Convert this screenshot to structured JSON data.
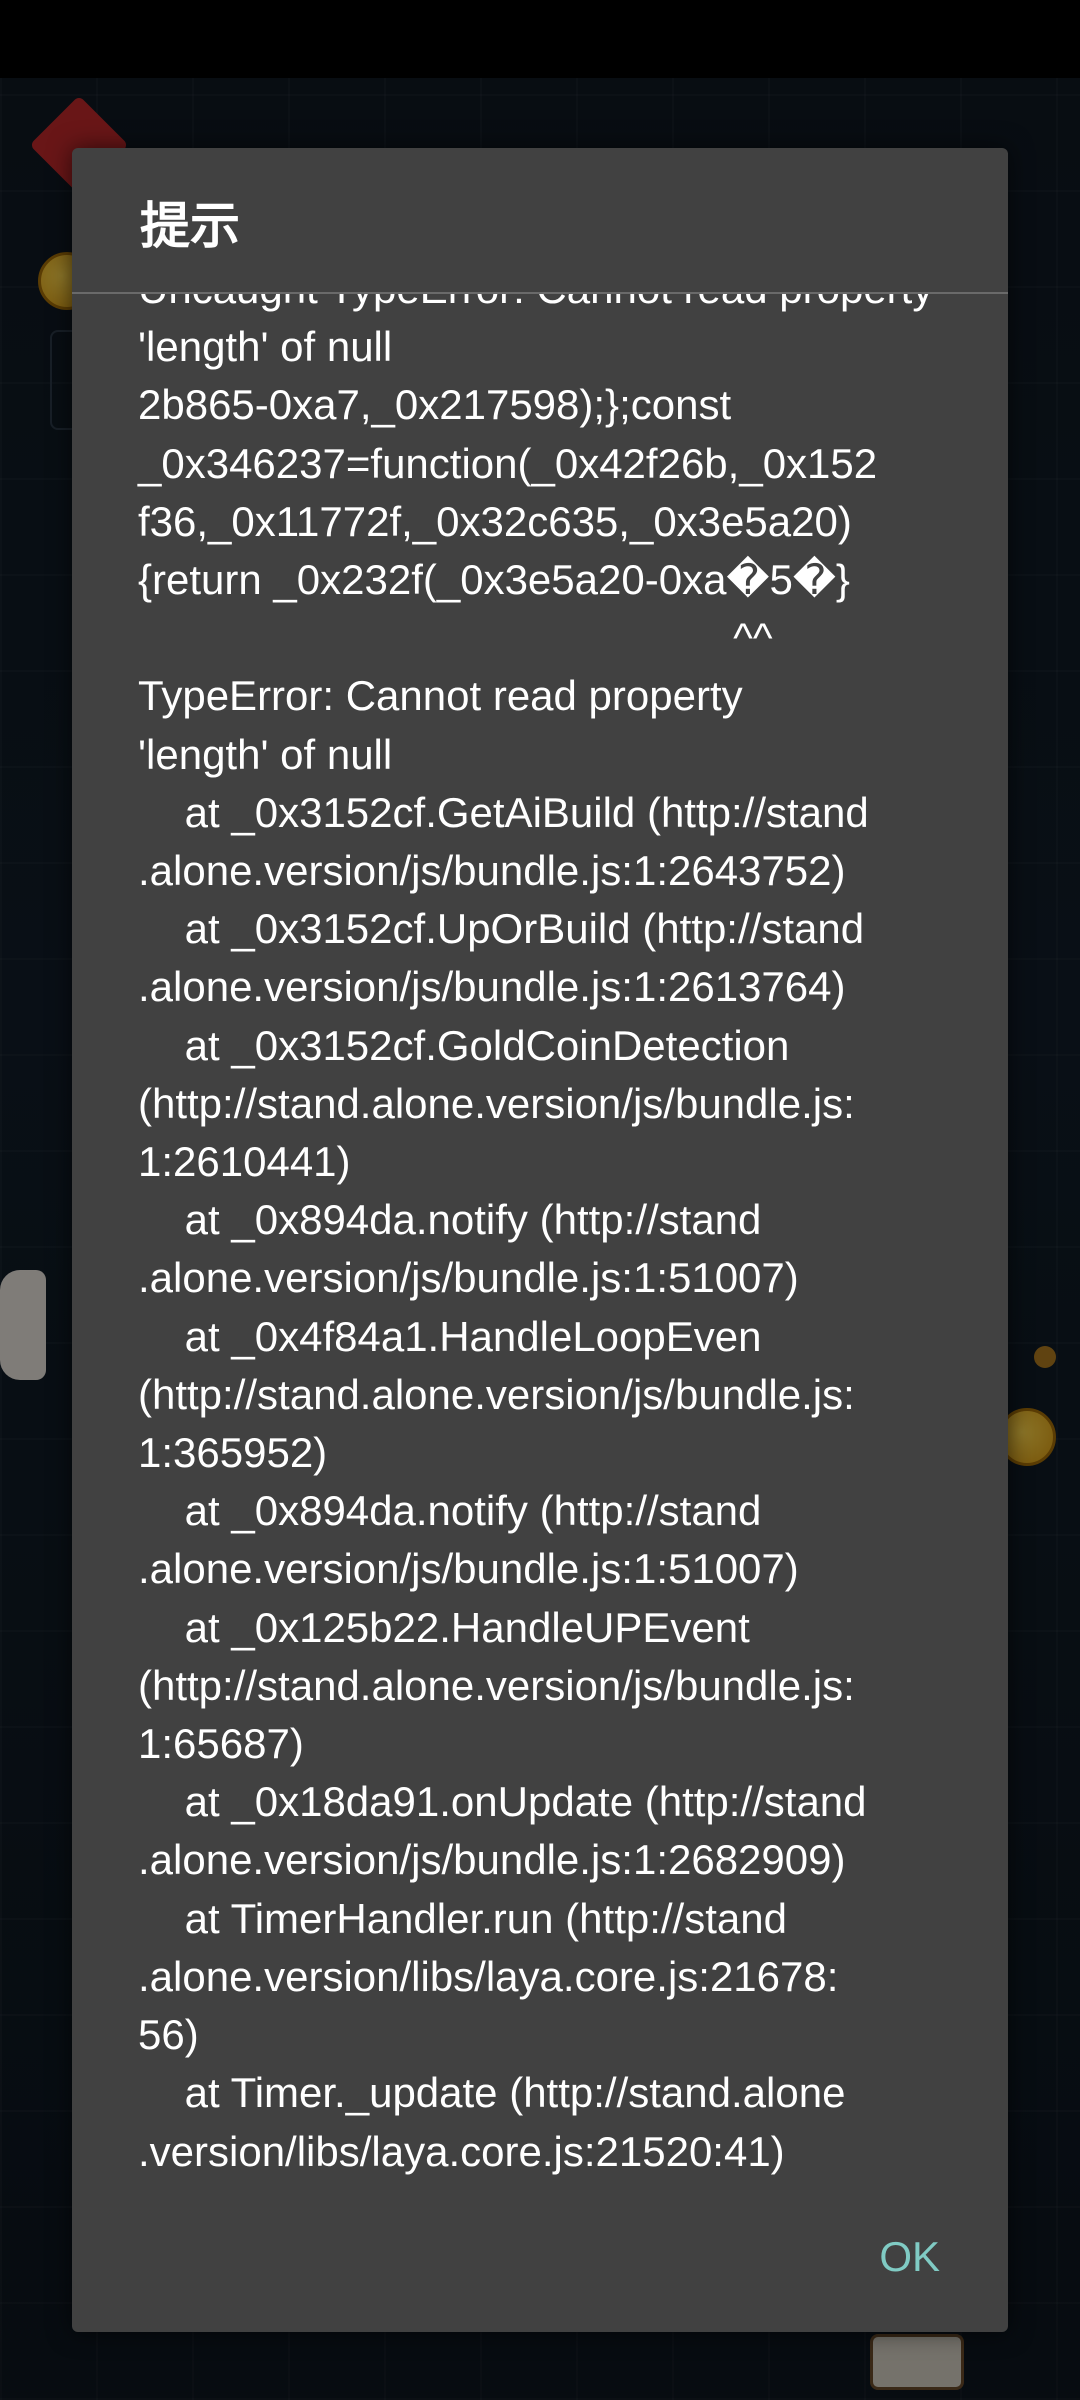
{
  "dialog": {
    "title": "提示",
    "message_lines": [
      "Uncaught TypeError: Cannot read property",
      "'length' of null",
      "2b865-0xa7,_0x217598);};const",
      "_0x346237=function(_0x42f26b,_0x152",
      "f36,_0x11772f,_0x32c635,_0x3e5a20)",
      "{return _0x232f(_0x3e5a20-0xa�5�}",
      "                                                   ^^",
      "TypeError: Cannot read property",
      "'length' of null",
      "    at _0x3152cf.GetAiBuild (http://stand",
      ".alone.version/js/bundle.js:1:2643752)",
      "    at _0x3152cf.UpOrBuild (http://stand",
      ".alone.version/js/bundle.js:1:2613764)",
      "    at _0x3152cf.GoldCoinDetection",
      "(http://stand.alone.version/js/bundle.js:",
      "1:2610441)",
      "    at _0x894da.notify (http://stand",
      ".alone.version/js/bundle.js:1:51007)",
      "    at _0x4f84a1.HandleLoopEven",
      "(http://stand.alone.version/js/bundle.js:",
      "1:365952)",
      "    at _0x894da.notify (http://stand",
      ".alone.version/js/bundle.js:1:51007)",
      "    at _0x125b22.HandleUPEvent",
      "(http://stand.alone.version/js/bundle.js:",
      "1:65687)",
      "    at _0x18da91.onUpdate (http://stand",
      ".alone.version/js/bundle.js:1:2682909)",
      "    at TimerHandler.run (http://stand",
      ".alone.version/libs/laya.core.js:21678:",
      "56)",
      "    at Timer._update (http://stand.alone",
      ".version/libs/laya.core.js:21520:41)"
    ],
    "ok_label": "OK"
  },
  "colors": {
    "dialog_background": "#414141",
    "ok_accent": "#80cbc4",
    "text": "#ffffff"
  }
}
